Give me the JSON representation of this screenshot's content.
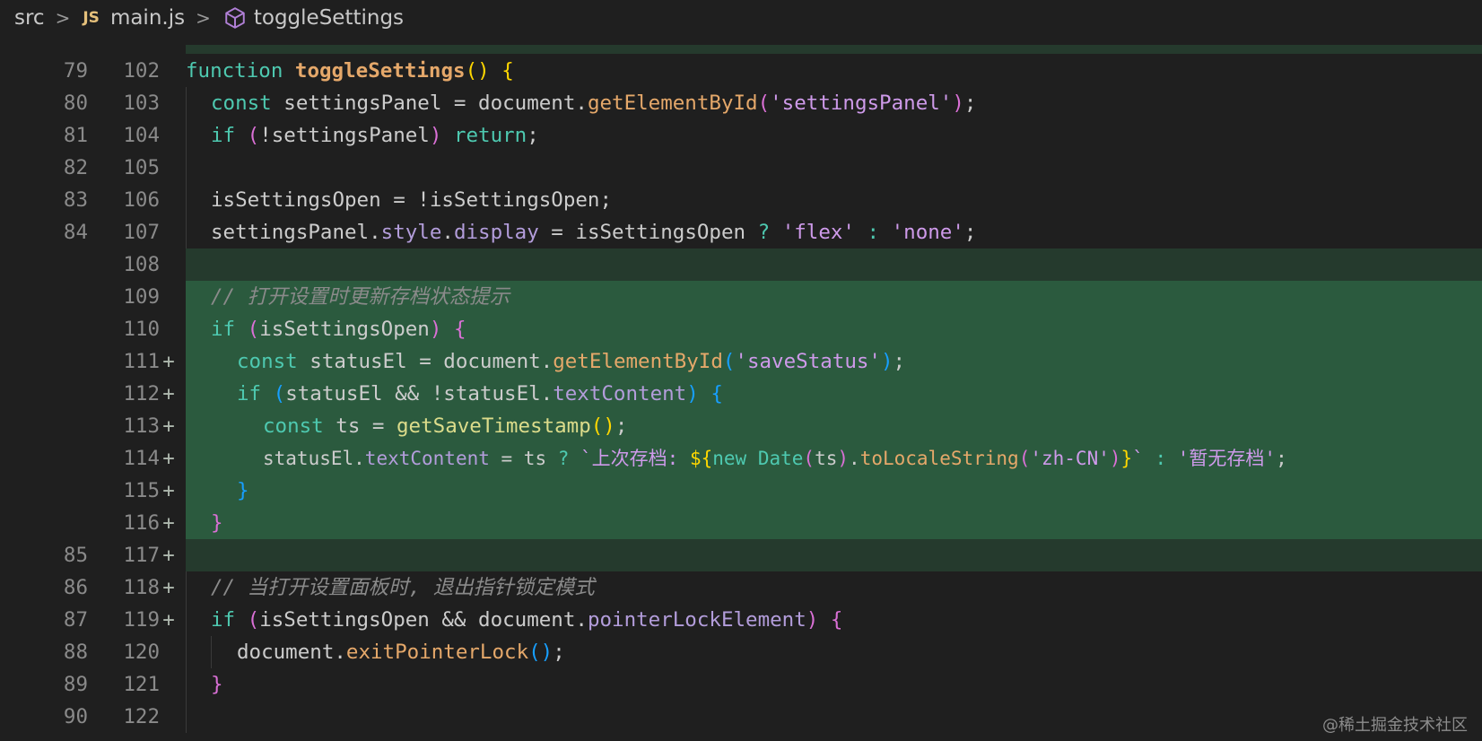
{
  "breadcrumb": {
    "folder": "src",
    "file_badge": "JS",
    "file": "main.js",
    "symbol": "toggleSettings",
    "separator": ">"
  },
  "lines": [
    {
      "old": "79",
      "new": "102",
      "marker": "",
      "type": "normal"
    },
    {
      "old": "80",
      "new": "103",
      "marker": "",
      "type": "normal"
    },
    {
      "old": "81",
      "new": "104",
      "marker": "",
      "type": "normal"
    },
    {
      "old": "82",
      "new": "105",
      "marker": "",
      "type": "normal"
    },
    {
      "old": "83",
      "new": "106",
      "marker": "",
      "type": "normal"
    },
    {
      "old": "84",
      "new": "107",
      "marker": "",
      "type": "normal"
    },
    {
      "old": "",
      "new": "108",
      "marker": "+",
      "type": "added-empty"
    },
    {
      "old": "",
      "new": "109",
      "marker": "+",
      "type": "added"
    },
    {
      "old": "",
      "new": "110",
      "marker": "+",
      "type": "added"
    },
    {
      "old": "",
      "new": "111",
      "marker": "+",
      "type": "added"
    },
    {
      "old": "",
      "new": "112",
      "marker": "+",
      "type": "added"
    },
    {
      "old": "",
      "new": "113",
      "marker": "+",
      "type": "added"
    },
    {
      "old": "",
      "new": "114",
      "marker": "+",
      "type": "added"
    },
    {
      "old": "",
      "new": "115",
      "marker": "+",
      "type": "added"
    },
    {
      "old": "",
      "new": "116",
      "marker": "+",
      "type": "added"
    },
    {
      "old": "85",
      "new": "117",
      "marker": "",
      "type": "added-empty"
    },
    {
      "old": "86",
      "new": "118",
      "marker": "",
      "type": "normal"
    },
    {
      "old": "87",
      "new": "119",
      "marker": "",
      "type": "normal"
    },
    {
      "old": "88",
      "new": "120",
      "marker": "",
      "type": "normal"
    },
    {
      "old": "89",
      "new": "121",
      "marker": "",
      "type": "normal"
    },
    {
      "old": "90",
      "new": "122",
      "marker": "",
      "type": "normal"
    }
  ],
  "code": {
    "l102": {
      "kw": "function",
      "name": "toggleSettings",
      "paren": "()",
      "brace": "{"
    },
    "l103": {
      "kw": "const",
      "rest": " settingsPanel = document.",
      "method": "getElementById",
      "open": "(",
      "str": "'settingsPanel'",
      "close": ")",
      "end": ";"
    },
    "l104": {
      "kw": "if",
      "open": "(",
      "rest": "!settingsPanel",
      "close": ")",
      "ret": "return",
      "end": ";"
    },
    "l106": {
      "text": "isSettingsOpen = !isSettingsOpen;"
    },
    "l107": {
      "a": "settingsPanel.",
      "p1": "style",
      "dot": ".",
      "p2": "display",
      "b": " = isSettingsOpen ",
      "q": "?",
      "s1": "'flex'",
      "c": " : ",
      "s2": "'none'",
      "end": ";"
    },
    "l109": {
      "comment": "// 打开设置时更新存档状态提示"
    },
    "l110": {
      "kw": "if",
      "open": "(",
      "rest": "isSettingsOpen",
      "close": ")",
      "brace": "{"
    },
    "l111": {
      "kw": "const",
      "rest": " statusEl = document.",
      "method": "getElementById",
      "open": "(",
      "str": "'saveStatus'",
      "close": ")",
      "end": ";"
    },
    "l112": {
      "kw": "if",
      "open": "(",
      "a": "statusEl && !statusEl.",
      "prop": "textContent",
      "close": ")",
      "brace": "{"
    },
    "l113": {
      "kw": "const",
      "rest": " ts = ",
      "method": "getSaveTimestamp",
      "paren": "()",
      "end": ";"
    },
    "l114": {
      "a": "statusEl.",
      "prop": "textContent",
      "b": " = ts ",
      "q": "?",
      "tpl1": " `上次存档: ",
      "dollar": "${",
      "new": "new",
      "cls": " Date",
      "open": "(",
      "ts": "ts",
      "close": ")",
      "dot": ".",
      "method": "toLocaleString",
      "open2": "(",
      "str": "'zh-CN'",
      "close2": ")",
      "rb": "}",
      "tpl2": "`",
      "c": " : ",
      "s2": "'暂无存档'",
      "end": ";"
    },
    "l115": {
      "brace": "}"
    },
    "l116": {
      "brace": "}"
    },
    "l118": {
      "comment": "// 当打开设置面板时, 退出指针锁定模式"
    },
    "l119": {
      "kw": "if",
      "open": "(",
      "a": "isSettingsOpen && document.",
      "prop": "pointerLockElement",
      "close": ")",
      "brace": "{"
    },
    "l120": {
      "a": "document.",
      "method": "exitPointerLock",
      "paren": "()",
      "end": ";"
    },
    "l121": {
      "brace": "}"
    }
  },
  "watermark": "@稀土掘金技术社区"
}
